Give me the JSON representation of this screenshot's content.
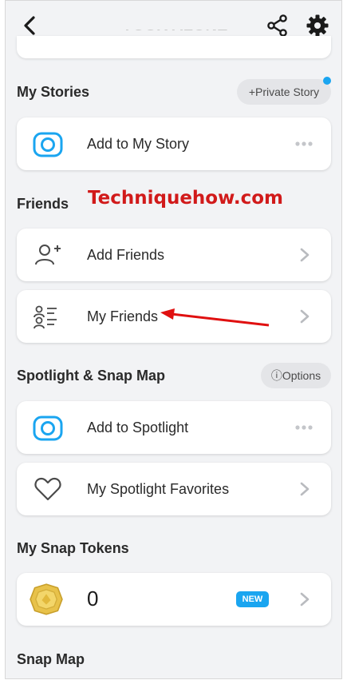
{
  "header": {
    "title": "YOUR ALONE",
    "back_icon": "chevron-left-icon",
    "share_icon": "share-icon",
    "settings_icon": "gear-icon"
  },
  "my_stories": {
    "title": "My Stories",
    "private_story_label": "+Private Story",
    "add_story_label": "Add to My Story"
  },
  "friends": {
    "title": "Friends",
    "add_friends_label": "Add Friends",
    "my_friends_label": "My Friends"
  },
  "watermark": "Techniquehow.com",
  "spotlight": {
    "title": "Spotlight & Snap Map",
    "options_label": "ⓘOptions",
    "add_spotlight_label": "Add to Spotlight",
    "favorites_label": "My Spotlight Favorites"
  },
  "tokens": {
    "title": "My Snap Tokens",
    "value": "0",
    "badge": "NEW"
  },
  "snap_map": {
    "title": "Snap Map"
  },
  "colors": {
    "accent_blue": "#1aa5f0",
    "background": "#f2f3f5",
    "watermark_red": "#d11a1a"
  }
}
